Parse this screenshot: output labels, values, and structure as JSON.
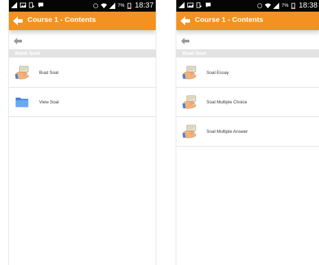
{
  "screens": [
    {
      "status_time": "18:37",
      "status_battery": "7%",
      "title": "Course 1 - Contents",
      "section_header": "Bank Soal",
      "items": [
        {
          "label": "Buat Soal",
          "icon": "teaching-hand-icon"
        },
        {
          "label": "View Soal",
          "icon": "folder-icon"
        }
      ]
    },
    {
      "status_time": "18:38",
      "status_battery": "7%",
      "title": "Course 1 - Contents",
      "section_header": "Buat Soal",
      "items": [
        {
          "label": "Soal Essay",
          "icon": "teaching-hand-icon"
        },
        {
          "label": "Soal Multiple Choice",
          "icon": "teaching-hand-icon"
        },
        {
          "label": "Soal Multiple Answer",
          "icon": "teaching-hand-icon"
        }
      ]
    }
  ],
  "colors": {
    "status_bar": "#050505",
    "top_bar": "#f39220",
    "section_header_bg": "#e3e3e3",
    "folder": "#4f8fe6"
  }
}
